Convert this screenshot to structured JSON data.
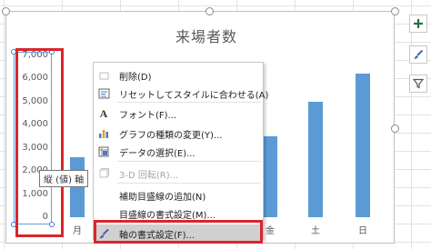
{
  "chart": {
    "title": "来場者数",
    "y_ticks": [
      "7,000",
      "6,000",
      "5,000",
      "4,000",
      "3,000",
      "2,000",
      "1,000",
      "0"
    ],
    "axis_tooltip": "縦 (値) 軸",
    "bar_color": "#5b9bd5"
  },
  "chart_data": {
    "type": "bar",
    "categories": [
      "月",
      "火",
      "水",
      "木",
      "金",
      "土",
      "日"
    ],
    "values": [
      2600,
      null,
      null,
      null,
      3500,
      5000,
      6200
    ],
    "title": "来場者数",
    "xlabel": "",
    "ylabel": "",
    "ylim": [
      0,
      7000
    ],
    "visible_category_labels": [
      "月",
      "金",
      "土",
      "日"
    ]
  },
  "context_menu": {
    "items": [
      {
        "icon": "delete-icon",
        "label": "削除(D)",
        "enabled": true
      },
      {
        "icon": "reset-style-icon",
        "label": "リセットしてスタイルに合わせる(A)",
        "enabled": true
      },
      {
        "icon": "font-icon",
        "label": "フォント(F)...",
        "enabled": true
      },
      {
        "icon": "chart-type-icon",
        "label": "グラフの種類の変更(Y)...",
        "enabled": true
      },
      {
        "icon": "select-data-icon",
        "label": "データの選択(E)...",
        "enabled": true
      },
      {
        "icon": "3d-rotation-icon",
        "label": "3-D 回転(R)...",
        "enabled": false
      },
      {
        "icon": "",
        "label": "補助目盛線の追加(N)",
        "enabled": true
      },
      {
        "icon": "",
        "label": "目盛線の書式設定(M)...",
        "enabled": true
      },
      {
        "icon": "format-axis-icon",
        "label": "軸の書式設定(F)...",
        "enabled": true
      }
    ]
  },
  "side_buttons": {
    "elements": "+",
    "styles": "brush",
    "filters": "filter"
  },
  "colors": {
    "highlight_border": "#d8262c",
    "selection": "#6aa0d8"
  }
}
